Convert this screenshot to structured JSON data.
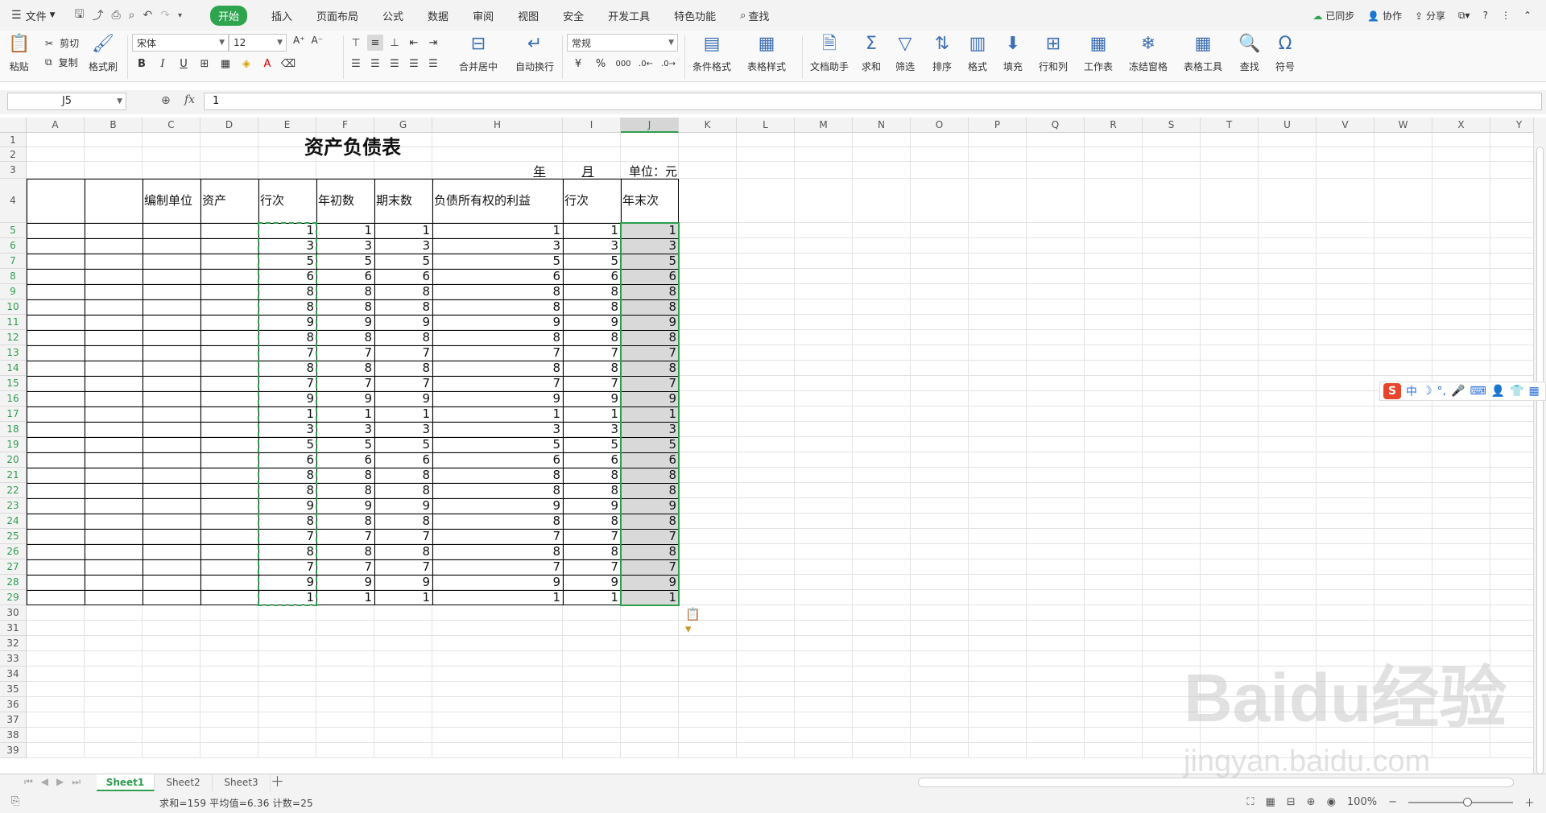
{
  "menubar": {
    "file_label": "文件",
    "tabs": [
      {
        "label": "开始",
        "active": true
      },
      {
        "label": "插入"
      },
      {
        "label": "页面布局"
      },
      {
        "label": "公式"
      },
      {
        "label": "数据"
      },
      {
        "label": "审阅"
      },
      {
        "label": "视图"
      },
      {
        "label": "安全"
      },
      {
        "label": "开发工具"
      },
      {
        "label": "特色功能"
      }
    ],
    "search_label": "查找",
    "right": {
      "sync": "已同步",
      "collab": "协作",
      "share": "分享",
      "help": "?"
    }
  },
  "ribbon": {
    "paste": "粘贴",
    "cut": "剪切",
    "copy": "复制",
    "format_painter": "格式刷",
    "font_name": "宋体",
    "font_size": "12",
    "merge_center": "合并居中",
    "wrap_text": "自动换行",
    "number_format": "常规",
    "percent": "%",
    "thousands": "000",
    "cond_format": "条件格式",
    "table_style": "表格样式",
    "doc_helper": "文档助手",
    "sum": "求和",
    "filter": "筛选",
    "sort": "排序",
    "format": "格式",
    "fill": "填充",
    "row_col": "行和列",
    "worksheet": "工作表",
    "freeze": "冻结窗格",
    "table_tools": "表格工具",
    "find": "查找",
    "symbol": "符号"
  },
  "formula_bar": {
    "name_box": "J5",
    "fx": "fx",
    "value": "1"
  },
  "columns": [
    "A",
    "B",
    "C",
    "D",
    "E",
    "F",
    "G",
    "H",
    "I",
    "J",
    "K",
    "L",
    "M",
    "N",
    "O",
    "P",
    "Q",
    "R",
    "S",
    "T",
    "U",
    "V",
    "W",
    "X",
    "Y"
  ],
  "rows": [
    "1",
    "2",
    "3",
    "4",
    "5",
    "6",
    "7",
    "8",
    "9",
    "10",
    "11",
    "12",
    "13",
    "14",
    "15",
    "16",
    "17",
    "18",
    "19",
    "20",
    "21",
    "22",
    "23",
    "24",
    "25",
    "26",
    "27",
    "28",
    "29",
    "30",
    "31",
    "32",
    "33",
    "34",
    "35",
    "36",
    "37",
    "38",
    "39"
  ],
  "sheet": {
    "title": "资产负债表",
    "unit_year": "年",
    "unit_month": "月",
    "unit_label": "单位：元",
    "headers": {
      "C": "编制单位",
      "D": "资产",
      "E": "行次",
      "F": "年初数",
      "G": "期末数",
      "H": "负债所有权的利益",
      "I": "行次",
      "J": "年末次"
    },
    "values": [
      1,
      3,
      5,
      6,
      8,
      8,
      9,
      8,
      7,
      8,
      7,
      9,
      1,
      3,
      5,
      6,
      8,
      8,
      9,
      8,
      7,
      8,
      7,
      9,
      1
    ]
  },
  "sheet_tabs": [
    {
      "label": "Sheet1",
      "active": true
    },
    {
      "label": "Sheet2"
    },
    {
      "label": "Sheet3"
    }
  ],
  "status": {
    "summary": "求和=159  平均值=6.36  计数=25",
    "zoom": "100%"
  },
  "ime": {
    "lang": "中"
  },
  "watermark": {
    "main": "Baidu经验",
    "sub": "jingyan.baidu.com"
  },
  "colors": {
    "accent": "#2ea44f",
    "selection": "#2e9e4f",
    "shade": "#d9d9d9"
  }
}
